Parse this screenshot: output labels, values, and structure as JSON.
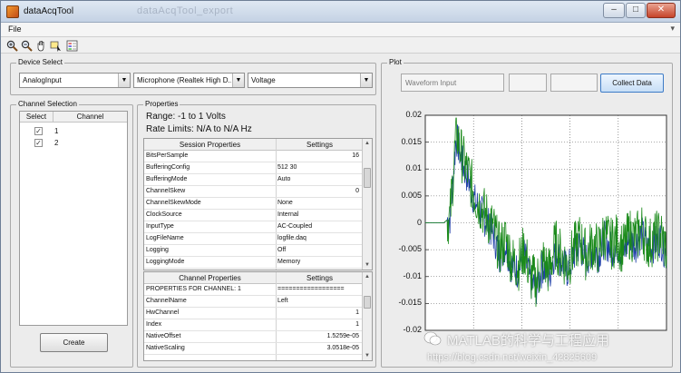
{
  "window": {
    "title": "dataAcqTool",
    "ghost_title": "dataAcqTool_export",
    "buttons": {
      "minimize": "–",
      "maximize": "□",
      "close": "✕"
    }
  },
  "menu": {
    "file": "File",
    "arrow": "▾"
  },
  "toolbar": {
    "icons": [
      "zoom-in-icon",
      "zoom-out-icon",
      "pan-icon",
      "data-cursor-icon",
      "legend-icon"
    ]
  },
  "device_select": {
    "label": "Device Select",
    "adaptor": "AnalogInput",
    "device": "Microphone (Realtek High D...",
    "channel_type": "Voltage"
  },
  "channel_selection": {
    "label": "Channel Selection",
    "col_select": "Select",
    "col_channel": "Channel",
    "rows": [
      {
        "checked": "✓",
        "channel": "1"
      },
      {
        "checked": "✓",
        "channel": "2"
      }
    ],
    "create_button": "Create"
  },
  "properties": {
    "label": "Properties",
    "range": "Range: -1 to 1 Volts",
    "rate_limits": "Rate Limits: N/A to N/A Hz",
    "session": {
      "col1": "Session Properties",
      "col2": "Settings",
      "rows": [
        {
          "name": "BitsPerSample",
          "value": "",
          "right": "16"
        },
        {
          "name": "BufferingConfig",
          "value": "512   30",
          "right": ""
        },
        {
          "name": "BufferingMode",
          "value": "Auto",
          "right": ""
        },
        {
          "name": "ChannelSkew",
          "value": "",
          "right": "0"
        },
        {
          "name": "ChannelSkewMode",
          "value": "None",
          "right": ""
        },
        {
          "name": "ClockSource",
          "value": "Internal",
          "right": ""
        },
        {
          "name": "InputType",
          "value": "AC-Coupled",
          "right": ""
        },
        {
          "name": "LogFileName",
          "value": "logfile.daq",
          "right": ""
        },
        {
          "name": "Logging",
          "value": "Off",
          "right": ""
        },
        {
          "name": "LoggingMode",
          "value": "Memory",
          "right": ""
        }
      ]
    },
    "channel": {
      "col1": "Channel Properties",
      "col2": "Settings",
      "rows": [
        {
          "name": "PROPERTIES FOR CHANNEL: 1",
          "value": "==================",
          "right": ""
        },
        {
          "name": "ChannelName",
          "value": "Left",
          "right": ""
        },
        {
          "name": "HwChannel",
          "value": "",
          "right": "1"
        },
        {
          "name": "Index",
          "value": "",
          "right": "1"
        },
        {
          "name": "NativeOffset",
          "value": "",
          "right": "1.5259e-05"
        },
        {
          "name": "NativeScaling",
          "value": "",
          "right": "3.0518e-05"
        }
      ]
    }
  },
  "plot": {
    "label": "Plot",
    "waveform_input": "Waveform Input",
    "collect_button": "Collect Data"
  },
  "chart_data": {
    "type": "line",
    "title": "",
    "xlabel": "",
    "ylabel": "",
    "ylim": [
      -0.02,
      0.02
    ],
    "yticks": [
      "0.02",
      "0.015",
      "0.01",
      "0.005",
      "0",
      "-0.005",
      "-0.01",
      "-0.015",
      "-0.02"
    ],
    "grid": true,
    "series": [
      {
        "color": "#1f3fa8",
        "trace": [
          0,
          0,
          0,
          0,
          0.001,
          0.016,
          0.011,
          0.008,
          0.004,
          0.002,
          0.0,
          -0.002,
          -0.006,
          -0.004,
          -0.008,
          -0.009,
          -0.006,
          -0.011,
          -0.012,
          -0.008,
          -0.01,
          -0.005,
          -0.007,
          -0.009,
          -0.006,
          -0.004,
          -0.007,
          -0.005,
          -0.006,
          -0.003,
          -0.005,
          -0.004,
          -0.006,
          -0.003,
          -0.004,
          -0.002,
          -0.005,
          -0.004,
          -0.003,
          -0.006
        ]
      },
      {
        "color": "#1a8a1a",
        "trace": [
          0,
          0,
          0,
          0,
          0.001,
          0.017,
          0.012,
          0.009,
          0.005,
          0.003,
          0.001,
          -0.001,
          -0.005,
          -0.003,
          -0.007,
          -0.008,
          -0.005,
          -0.01,
          -0.011,
          -0.007,
          -0.009,
          -0.004,
          -0.006,
          -0.008,
          -0.005,
          -0.003,
          -0.006,
          -0.004,
          -0.005,
          -0.002,
          -0.004,
          -0.003,
          -0.005,
          -0.002,
          -0.003,
          -0.001,
          -0.004,
          -0.003,
          -0.002,
          -0.005
        ]
      }
    ]
  },
  "watermark": {
    "brand": "MATLAB的科学与工程应用",
    "url": "https://blog.csdn.net/weixin_42825609"
  }
}
